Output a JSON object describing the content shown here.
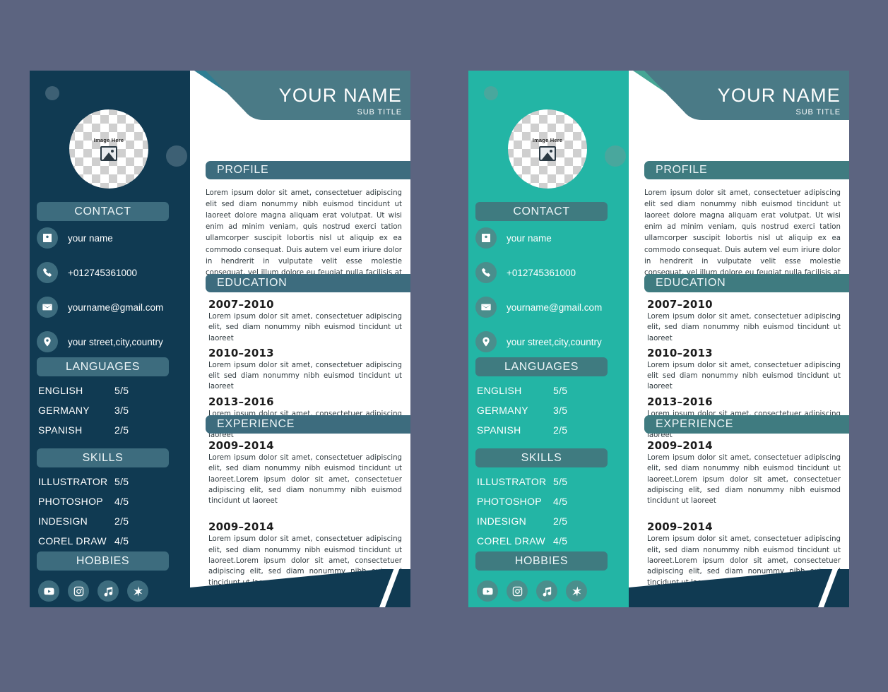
{
  "background_color": "#5c6480",
  "cards": [
    {
      "id": "card-dark",
      "sidebar_color": "#103a52",
      "accent_color": "#3d6c7e",
      "header_stripe_color": "#2e7e93",
      "variant_name": "navy"
    },
    {
      "id": "card-teal",
      "sidebar_color": "#23b5a5",
      "accent_color": "#3f7b80",
      "header_stripe_color": "#46a695",
      "variant_name": "turquoise"
    }
  ],
  "resume": {
    "avatar": {
      "label": "Image Here",
      "icon": "image-placeholder-icon"
    },
    "header": {
      "name": "YOUR NAME",
      "subtitle": "SUB TITLE"
    },
    "sections": {
      "contact": "CONTACT",
      "languages": "LANGUAGES",
      "skills": "SKILLS",
      "hobbies": "HOBBIES",
      "profile": "PROFILE",
      "education": "EDUCATION",
      "experience": "EXPERIENCE"
    },
    "contact": [
      {
        "icon": "user-badge-icon",
        "value": "your name"
      },
      {
        "icon": "phone-icon",
        "value": "+012745361000"
      },
      {
        "icon": "envelope-icon",
        "value": "yourname@gmail.com"
      },
      {
        "icon": "location-pin-icon",
        "value": "your street,city,country"
      }
    ],
    "languages": [
      {
        "name": "ENGLISH",
        "rating": "5/5"
      },
      {
        "name": "GERMANY",
        "rating": "3/5"
      },
      {
        "name": "SPANISH",
        "rating": "2/5"
      }
    ],
    "skills": [
      {
        "name": "ILLUSTRATOR",
        "rating": "5/5"
      },
      {
        "name": "PHOTOSHOP",
        "rating": "4/5"
      },
      {
        "name": "INDESIGN",
        "rating": "2/5"
      },
      {
        "name": "COREL DRAW",
        "rating": "4/5"
      }
    ],
    "hobbies": [
      {
        "icon": "youtube-icon"
      },
      {
        "icon": "instagram-icon"
      },
      {
        "icon": "music-note-icon"
      },
      {
        "icon": "star-icon"
      }
    ],
    "profile_text": "Lorem ipsum dolor sit amet, consectetuer adipiscing elit sed diam nonummy nibh euismod tincidunt ut laoreet dolore magna aliquam erat volutpat. Ut wisi enim ad minim veniam, quis nostrud exerci tation ullamcorper suscipit lobortis nisl ut aliquip ex ea commodo consequat. Duis autem vel eum iriure dolor in hendrerit in vulputate velit esse molestie consequat, vel illum dolore eu feugiat nulla facilisis at vero eros et accumsan et iusto odio dignissim qu",
    "education": [
      {
        "date": "2007–2010",
        "desc": "Lorem ipsum dolor sit amet, consectetuer adipiscing elit, sed diam nonummy nibh euismod tincidunt ut laoreet"
      },
      {
        "date": "2010–2013",
        "desc": "Lorem ipsum dolor sit amet, consectetuer adipiscing elit sed diam nonummy nibh euismod tincidunt ut laoreet"
      },
      {
        "date": "2013–2016",
        "desc": "Lorem ipsum dolor sit amet, consectetuer adipiscing elit, sed diam nonummy nibh euismod tincidunt ut laoreet"
      }
    ],
    "experience": [
      {
        "date": "2009–2014",
        "desc": "Lorem ipsum dolor sit amet, consectetuer adipiscing elit, sed diam nonummy nibh euismod tincidunt ut laoreet.Lorem ipsum dolor sit amet, consectetuer adipiscing elit, sed diam nonummy nibh euismod tincidunt ut laoreet"
      },
      {
        "date": "2009–2014",
        "desc": "Lorem ipsum dolor sit amet, consectetuer adipiscing elit, sed diam nonummy nibh euismod tincidunt ut laoreet.Lorem ipsum dolor sit amet, consectetuer adipiscing elit, sed diam nonummy nibh euismod tincidunt ut laoreet"
      }
    ]
  }
}
